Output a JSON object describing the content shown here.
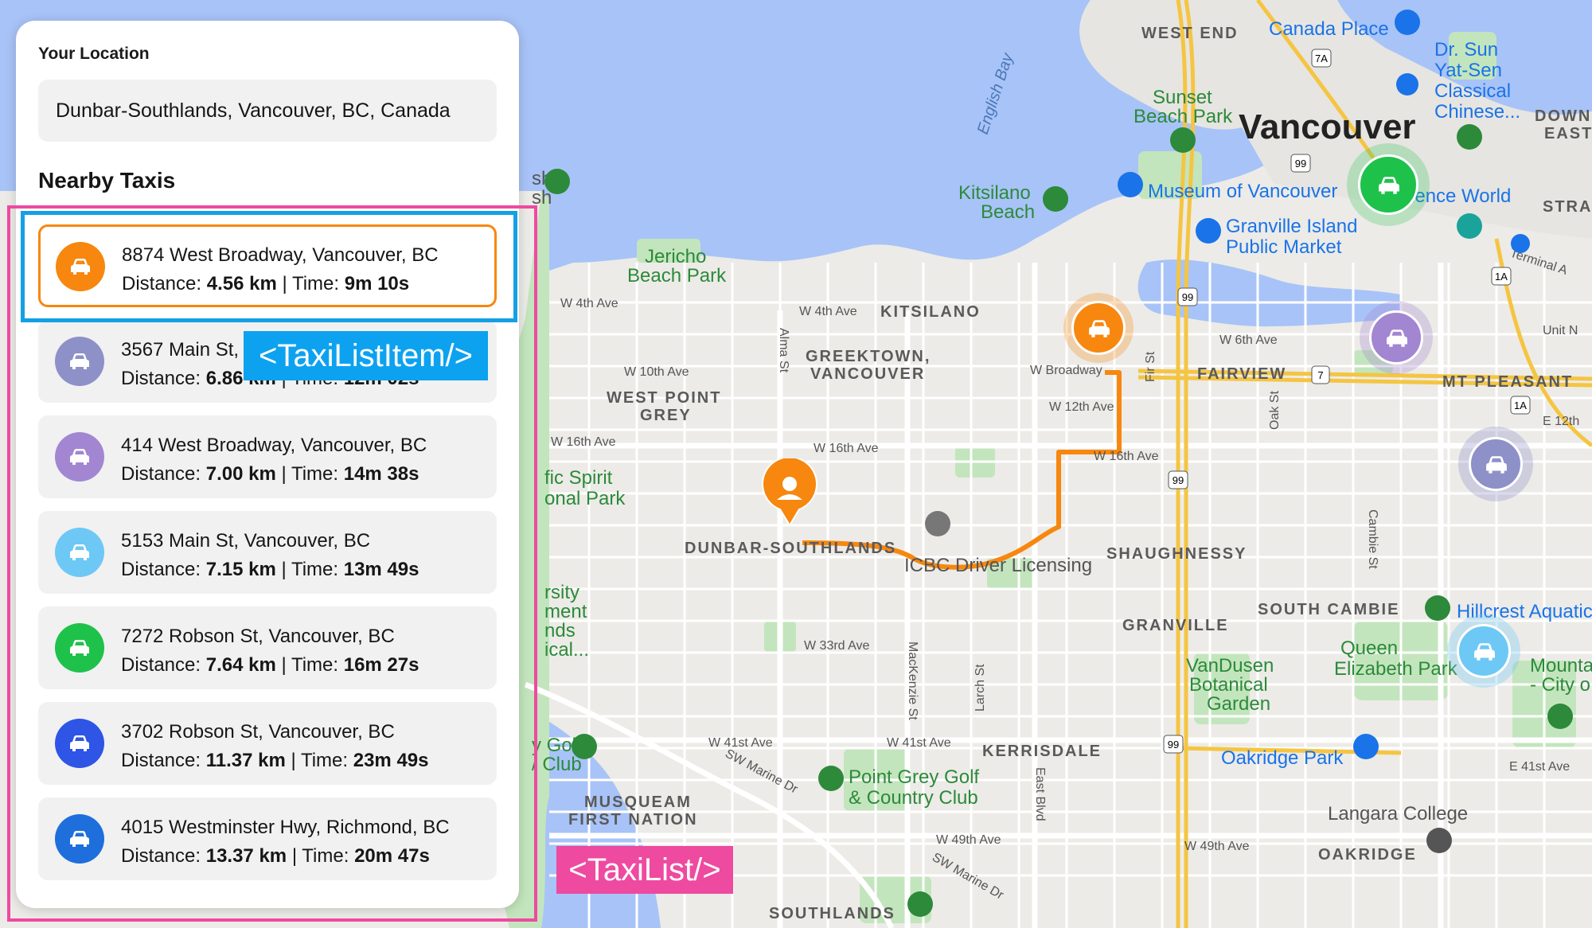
{
  "panel": {
    "location_label": "Your Location",
    "location_value": "Dunbar-Southlands, Vancouver, BC, Canada",
    "nearby_title": "Nearby Taxis",
    "distance_label": "Distance:",
    "time_label": "Time:",
    "separator": "|",
    "taxis": [
      {
        "address": "8874 West Broadway, Vancouver, BC",
        "distance": "4.56 km",
        "time": "9m 10s",
        "color": "#f7870f",
        "selected": true
      },
      {
        "address": "3567 Main St, Vancouver, BC",
        "distance": "6.86 km",
        "time": "12m 02s",
        "color": "#8e90c8",
        "selected": false
      },
      {
        "address": "414 West Broadway, Vancouver, BC",
        "distance": "7.00 km",
        "time": "14m 38s",
        "color": "#a286d2",
        "selected": false
      },
      {
        "address": "5153 Main St, Vancouver, BC",
        "distance": "7.15 km",
        "time": "13m 49s",
        "color": "#6ec8f5",
        "selected": false
      },
      {
        "address": "7272 Robson St, Vancouver, BC",
        "distance": "7.64 km",
        "time": "16m 27s",
        "color": "#1ec24a",
        "selected": false
      },
      {
        "address": "3702 Robson St, Vancouver, BC",
        "distance": "11.37 km",
        "time": "23m 49s",
        "color": "#2e55e6",
        "selected": false
      },
      {
        "address": "4015 Westminster Hwy, Richmond, BC",
        "distance": "13.37 km",
        "time": "20m 47s",
        "color": "#1e6fdc",
        "selected": false
      }
    ]
  },
  "annotations": {
    "item_tag": "<TaxiListItem/>",
    "list_tag": "<TaxiList/>"
  },
  "map": {
    "areas": [
      "WEST END",
      "KITSILANO",
      "GREEKTOWN,",
      "VANCOUVER",
      "WEST POINT",
      "GREY",
      "FAIRVIEW",
      "MT PLEASANT",
      "DUNBAR-SOUTHLANDS",
      "SHAUGHNESSY",
      "GRANVILLE",
      "SOUTH CAMBIE",
      "KERRISDALE",
      "OAKRIDGE",
      "SOUTHLANDS",
      "MUSQUEAM",
      "FIRST NATION",
      "DOWN",
      "EAST",
      "STRA"
    ],
    "city": "Vancouver",
    "streets": [
      "W 4th Ave",
      "W 10th Ave",
      "W 16th Ave",
      "W 33rd Ave",
      "W 41st Ave",
      "W 49th Ave",
      "W Broadway",
      "W 12th Ave",
      "W 6th Ave",
      "Alma St",
      "Fir St",
      "Oak St",
      "Cambie St",
      "MacKenzie St",
      "Larch St",
      "East Blvd",
      "SW Marine Dr",
      "E 41st Ave",
      "E 12th",
      "Terminal A"
    ],
    "pois": [
      "Canada Place",
      "Dr. Sun Yat-Sen Classical Chinese...",
      "Sunset Beach Park",
      "English Bay",
      "Kitsilano Beach",
      "Museum of Vancouver",
      "Science World",
      "Granville Island Public Market",
      "Jericho Beach Park",
      "Pacific Spirit Regional Park",
      "ICBC Driver Licensing",
      "VanDusen Botanical Garden",
      "Queen Elizabeth Park",
      "Hillcrest Aquatic",
      "Oakridge Park",
      "Point Grey Golf & Country Club",
      "Langara College",
      "Mountain View Cemetery"
    ],
    "highways": [
      "99",
      "7A",
      "1A",
      "7"
    ]
  }
}
